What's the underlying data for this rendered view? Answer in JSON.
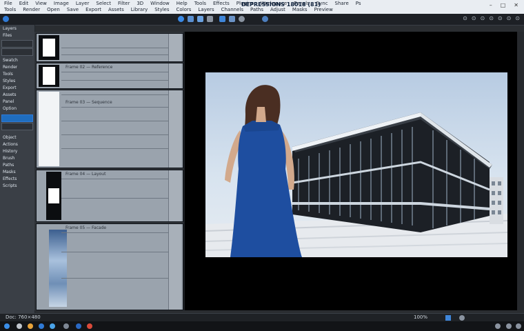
{
  "app": {
    "title": "DEPRESSIONS 18018 (81)",
    "menu_top": [
      "File",
      "Edit",
      "View",
      "Image",
      "Layer",
      "Select",
      "Filter",
      "3D",
      "Window",
      "Help",
      "Tools",
      "Effects",
      "Plugins",
      "Workspace",
      "Panels",
      "Sync",
      "Share",
      "Ps"
    ],
    "menu_bottom": [
      "Tools",
      "Render",
      "Open",
      "Save",
      "Export",
      "Assets",
      "Library",
      "Styles",
      "Colors",
      "Layers",
      "Channels",
      "Paths",
      "Adjust",
      "Masks",
      "Preview"
    ]
  },
  "window_controls": {
    "minimize": "–",
    "maximize": "□",
    "close": "✕"
  },
  "toolbar": {
    "right_icons": [
      "⊙",
      "⊙",
      "⊙",
      "⊙",
      "⊙",
      "⊙",
      "⊙"
    ]
  },
  "left_panel": {
    "items": [
      "Layers",
      "Files",
      "Swatch",
      "Render",
      "Tools",
      "Styles",
      "Export",
      "Assets",
      "Panel",
      "Option",
      "Object",
      "Actions",
      "History",
      "Brush",
      "Paths",
      "Masks",
      "Effects",
      "Scripts"
    ]
  },
  "strips": [
    {
      "label": ""
    },
    {
      "label": "Frame 02 — Reference"
    },
    {
      "label": "Frame 03 — Sequence"
    },
    {
      "label": "Frame 04 — Layout"
    },
    {
      "label": "Frame 05 — Facade"
    }
  ],
  "canvas": {
    "image_description": "rendered scene",
    "colors": {
      "dress": "#1e4ea0",
      "hair": "#4a2e22",
      "sky": "#b7cbe2"
    }
  },
  "status": {
    "left": "Doc: 760×480",
    "zoom": "100%"
  }
}
